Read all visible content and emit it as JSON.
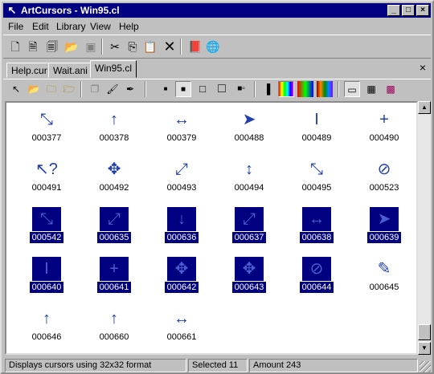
{
  "window": {
    "title": "ArtCursors - Win95.cl"
  },
  "menu": [
    "File",
    "Edit",
    "Library",
    "View",
    "Help"
  ],
  "tabs": [
    {
      "label": "Help.cur"
    },
    {
      "label": "Wait.ani"
    },
    {
      "label": "Win95.cl"
    }
  ],
  "toolbar1_icons": [
    "new-icon",
    "new-cursor-icon",
    "new-library-icon",
    "open-icon",
    "save-icon",
    "cut-icon",
    "copy-icon",
    "paste-icon",
    "delete-icon",
    "book-icon",
    "globe-icon"
  ],
  "toolbar2_icons": [
    "select-icon",
    "folder-open-icon",
    "folder-icon",
    "folder-open2-icon",
    "copy-layer-icon",
    "brush-icon",
    "pen-icon",
    "size16-icon",
    "size32-icon",
    "size48-icon",
    "size64-icon",
    "size-custom-icon",
    "bw-icon",
    "color16-icon",
    "color256-icon",
    "colortrue-icon",
    "edit-icon",
    "animate-icon",
    "grid-icon"
  ],
  "cells": [
    {
      "label": "000377",
      "glyph": "⤡",
      "sel": false
    },
    {
      "label": "000378",
      "glyph": "↑",
      "sel": false
    },
    {
      "label": "000379",
      "glyph": "↔",
      "sel": false
    },
    {
      "label": "000488",
      "glyph": "➤",
      "sel": false
    },
    {
      "label": "000489",
      "glyph": "I",
      "sel": false
    },
    {
      "label": "000490",
      "glyph": "+",
      "sel": false
    },
    {
      "label": "000491",
      "glyph": "↖?",
      "sel": false
    },
    {
      "label": "000492",
      "glyph": "✥",
      "sel": false
    },
    {
      "label": "000493",
      "glyph": "⤢",
      "sel": false
    },
    {
      "label": "000494",
      "glyph": "↕",
      "sel": false
    },
    {
      "label": "000495",
      "glyph": "⤡",
      "sel": false
    },
    {
      "label": "000523",
      "glyph": "⊘",
      "sel": false
    },
    {
      "label": "000542",
      "glyph": "⤡",
      "sel": true
    },
    {
      "label": "000635",
      "glyph": "⤢",
      "sel": true
    },
    {
      "label": "000636",
      "glyph": "↓",
      "sel": true
    },
    {
      "label": "000637",
      "glyph": "⤢",
      "sel": true
    },
    {
      "label": "000638",
      "glyph": "↔",
      "sel": true
    },
    {
      "label": "000639",
      "glyph": "➤",
      "sel": true
    },
    {
      "label": "000640",
      "glyph": "I",
      "sel": true
    },
    {
      "label": "000641",
      "glyph": "+",
      "sel": true
    },
    {
      "label": "000642",
      "glyph": "✥",
      "sel": true
    },
    {
      "label": "000643",
      "glyph": "✥",
      "sel": true
    },
    {
      "label": "000644",
      "glyph": "⊘",
      "sel": true
    },
    {
      "label": "000645",
      "glyph": "✎",
      "sel": false
    },
    {
      "label": "000646",
      "glyph": "↑",
      "sel": false
    },
    {
      "label": "000660",
      "glyph": "↑",
      "sel": false
    },
    {
      "label": "000661",
      "glyph": "↔",
      "sel": false
    }
  ],
  "status": {
    "message": "Displays cursors using 32x32 format",
    "selected": "Selected 11",
    "amount": "Amount 243"
  }
}
